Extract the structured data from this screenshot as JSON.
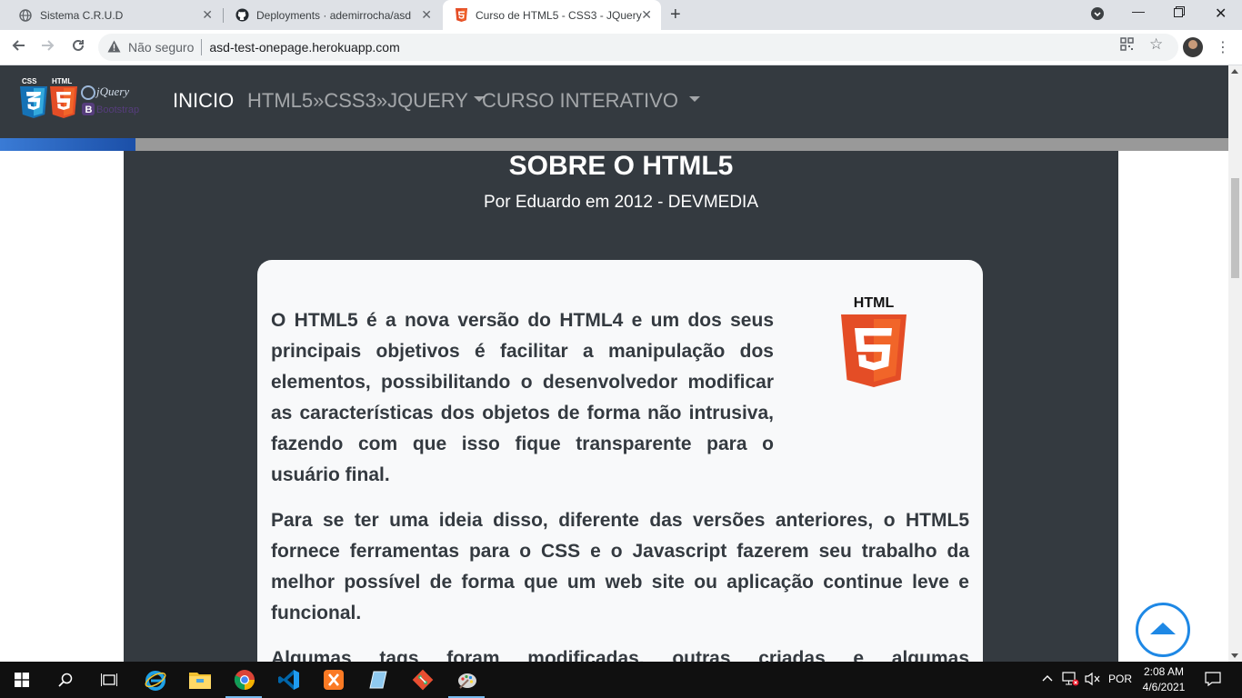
{
  "browser": {
    "tabs": [
      {
        "title": "Sistema C.R.U.D",
        "favicon": "globe-icon",
        "active": false
      },
      {
        "title": "Deployments · ademirrocha/asd-",
        "favicon": "github-icon",
        "active": false
      },
      {
        "title": "Curso de HTML5 - CSS3 - JQuery",
        "favicon": "html5-icon",
        "active": true
      }
    ],
    "insecure_label": "Não seguro",
    "url": "asd-test-onepage.herokuapp.com"
  },
  "navbar": {
    "logo_text": {
      "css": "CSS",
      "html": "HTML",
      "jquery": "jQuery",
      "bootstrap": "Bootstrap"
    },
    "items": [
      {
        "label": "INICIO",
        "active": true,
        "dropdown": false
      },
      {
        "label": "HTML5»CSS3»JQUERY",
        "active": false,
        "dropdown": true
      },
      {
        "label": "CURSO INTERATIVO",
        "active": false,
        "dropdown": true
      }
    ]
  },
  "progress": {
    "fraction": 0.11,
    "color": "#1b4fa8"
  },
  "section": {
    "title": "SOBRE O HTML5",
    "subtitle": "Por Eduardo em 2012 - DEVMEDIA",
    "paragraphs": [
      "O HTML5 é a nova versão do HTML4 e um dos seus principais objetivos é facilitar a manipulação dos elementos, possibilitando o desenvolvedor modificar as características dos objetos de forma não intrusiva, fazendo com que isso fique transparente para o usuário final.",
      "Para se ter uma ideia disso, diferente das versões anteriores, o HTML5 fornece ferramentas para o CSS e o Javascript fazerem seu trabalho da melhor possível de forma que um web site ou aplicação continue leve e funcional.",
      "Algumas tags foram modificadas, outras criadas e algumas"
    ],
    "image_label": "HTML"
  },
  "taskbar": {
    "language": "POR",
    "time": "2:08 AM",
    "date": "4/6/2021"
  },
  "colors": {
    "navbar_bg": "#343a40",
    "card_bg": "#f8f9fa",
    "accent_blue": "#1e88e5",
    "html5_orange": "#e44d26"
  }
}
